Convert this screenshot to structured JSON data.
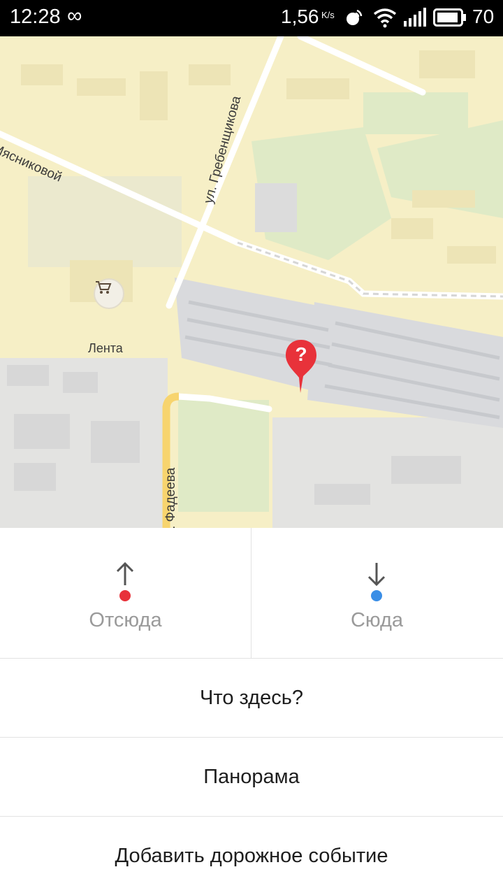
{
  "status_bar": {
    "time": "12:28",
    "infinity_glyph": "∞",
    "net_speed": "1,56",
    "net_speed_unit": "K/s",
    "battery": "70",
    "icons": [
      "infinity-icon",
      "signal-vibe-icon",
      "wifi-icon",
      "cell-signal-icon",
      "battery-icon"
    ]
  },
  "map": {
    "streets": [
      "Мясниковой",
      "ул. Гребенщикова",
      ". Фадеева"
    ],
    "poi_label": "Лента",
    "poi_icon": "shopping-cart-icon",
    "pin_icon": "question-pin-icon",
    "pin_glyph": "?",
    "colors": {
      "background": "#f6efc6",
      "park": "#dfeac6",
      "industrial": "#e3e3e1",
      "road": "#ffffff",
      "major_road": "#f7d46e",
      "pin": "#e8323a"
    }
  },
  "directions": {
    "from": {
      "label": "Отсюда",
      "dot_color": "#e8323a",
      "icon": "arrow-up-icon"
    },
    "to": {
      "label": "Сюда",
      "dot_color": "#3a8ee6",
      "icon": "arrow-down-icon"
    }
  },
  "menu": {
    "what_here": "Что здесь?",
    "panorama": "Панорама",
    "add_road_event": "Добавить дорожное событие"
  }
}
